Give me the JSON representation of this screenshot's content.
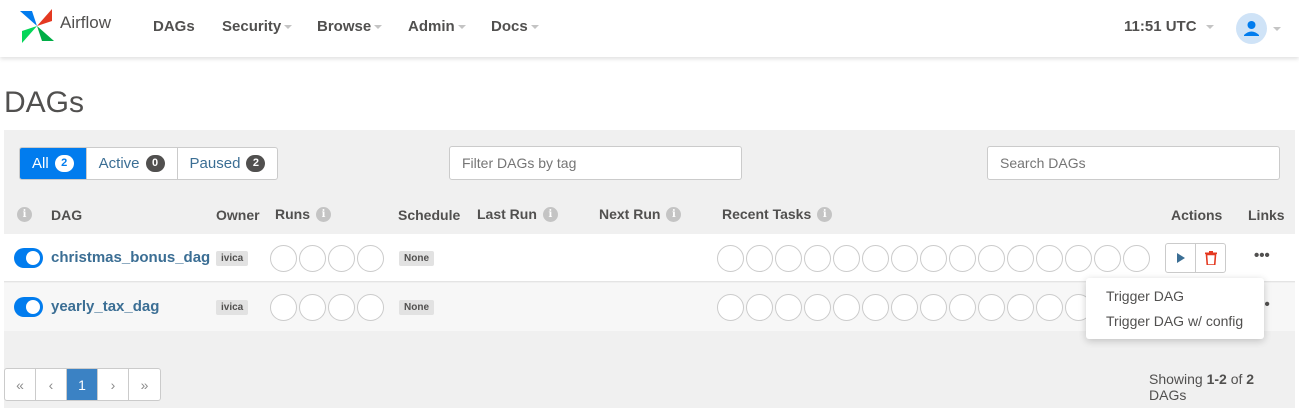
{
  "app": {
    "name": "Airflow"
  },
  "nav": {
    "items": [
      {
        "label": "DAGs",
        "dropdown": false
      },
      {
        "label": "Security",
        "dropdown": true
      },
      {
        "label": "Browse",
        "dropdown": true
      },
      {
        "label": "Admin",
        "dropdown": true
      },
      {
        "label": "Docs",
        "dropdown": true
      }
    ],
    "time": "11:51 UTC"
  },
  "page": {
    "title": "DAGs"
  },
  "filters": {
    "all": {
      "label": "All",
      "count": "2"
    },
    "active": {
      "label": "Active",
      "count": "0"
    },
    "paused": {
      "label": "Paused",
      "count": "2"
    },
    "tag_placeholder": "Filter DAGs by tag",
    "search_placeholder": "Search DAGs"
  },
  "table": {
    "headers": {
      "dag": "DAG",
      "owner": "Owner",
      "runs": "Runs",
      "schedule": "Schedule",
      "last_run": "Last Run",
      "next_run": "Next Run",
      "recent_tasks": "Recent Tasks",
      "actions": "Actions",
      "links": "Links"
    },
    "rows": [
      {
        "dag_id": "christmas_bonus_dag",
        "owner": "ivica",
        "schedule": "None",
        "active": true
      },
      {
        "dag_id": "yearly_tax_dag",
        "owner": "ivica",
        "schedule": "None",
        "active": true
      }
    ]
  },
  "trigger_menu": {
    "items": [
      "Trigger DAG",
      "Trigger DAG w/ config"
    ]
  },
  "pagination": {
    "first": "«",
    "prev": "‹",
    "current": "1",
    "next": "›",
    "last": "»"
  },
  "summary": {
    "prefix": "Showing ",
    "range": "1-2",
    "middle": " of ",
    "total": "2",
    "suffix": " DAGs"
  },
  "colors": {
    "primary": "#017cee",
    "link": "#3b6e94",
    "danger": "#e43921",
    "text": "#51504f"
  }
}
